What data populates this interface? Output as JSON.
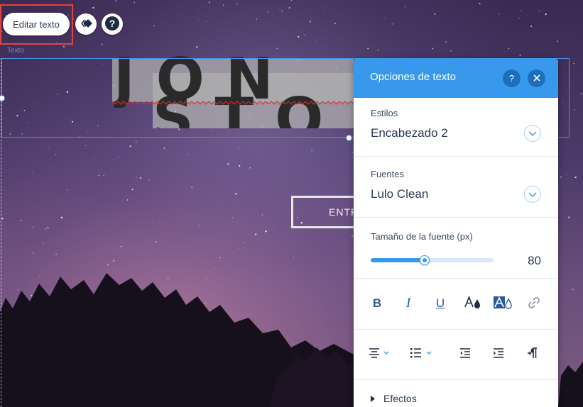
{
  "toolbar": {
    "edit_label": "Editar texto",
    "element_label": "Texto"
  },
  "canvas": {
    "title_line1": "JON",
    "title_line2": "STO",
    "cta_label": "ENTR"
  },
  "panel": {
    "title": "Opciones de texto",
    "help_label": "?",
    "styles": {
      "label": "Estilos",
      "value": "Encabezado 2"
    },
    "fonts": {
      "label": "Fuentes",
      "value": "Lulo Clean"
    },
    "size": {
      "label": "Tamaño de la fuente (px)",
      "value": "80",
      "slider_fraction": 0.44
    },
    "format_icons": [
      "bold-icon",
      "italic-icon",
      "underline-icon",
      "text-color-icon",
      "highlight-color-icon",
      "link-icon"
    ],
    "format_letters": {
      "bold": "B",
      "italic": "I",
      "underline": "U"
    },
    "align_icons": [
      "align-center-icon",
      "bullet-list-icon",
      "outdent-icon",
      "indent-icon",
      "rtl-icon"
    ],
    "effects_label": "Efectos"
  },
  "colors": {
    "accent": "#3899ec",
    "highlight_frame": "#e0443f",
    "selection": "#4a90e2"
  }
}
